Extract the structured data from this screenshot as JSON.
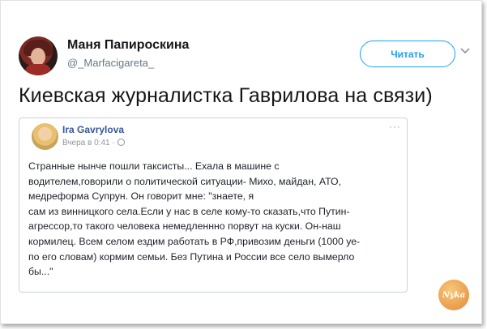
{
  "tweet": {
    "author_name": "Маня Папироскина",
    "author_handle": "@_Marfacigareta_",
    "follow_label": "Читать",
    "text": "Киевская журналистка Гаврилова на связи)"
  },
  "embedded_post": {
    "author_name": "Ira Gavrylova",
    "time": "Вчера в 0:41 ·",
    "more_label": "···",
    "lines": [
      "Странные нынче пошли таксисты... Ехала в машине с",
      "водителем,говорили о политической ситуации- Михо, майдан, АТО,",
      "медреформа Супрун. Он говорит мне: \"знаете, я",
      "сам из винницкого села.Если у нас в селе кому-то сказать,что Путин-",
      "агрессор,то такого человека немедленнно порвут на куски. Он-наш",
      "кормилец. Всем селом ездим работать в РФ,привозим деньги (1000 уе-",
      "по его словам) кормим семьи. Без Путина и России все село вымерло",
      "бы...\""
    ]
  },
  "watermark": {
    "text": "Nyka"
  },
  "icons": {
    "chevron": "chevron-down-icon",
    "globe": "globe-icon"
  },
  "colors": {
    "accent": "#1da1f2",
    "link": "#365899"
  }
}
